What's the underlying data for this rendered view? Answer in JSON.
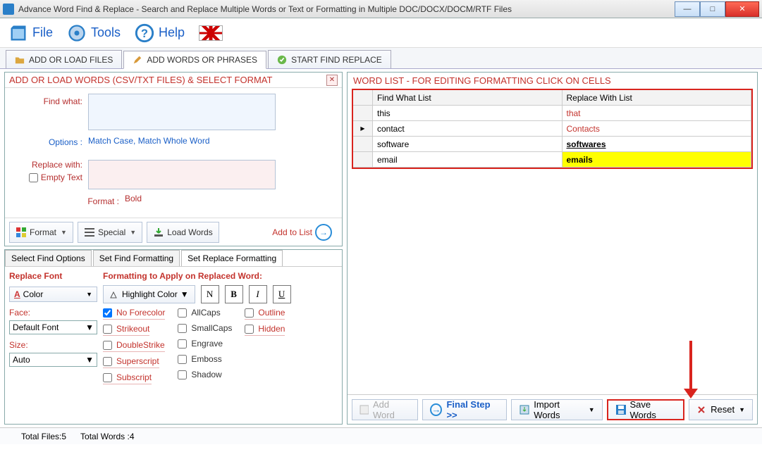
{
  "window": {
    "title": "Advance Word Find & Replace - Search and Replace Multiple Words or Text  or Formatting in Multiple DOC/DOCX/DOCM/RTF Files"
  },
  "menubar": {
    "file": "File",
    "tools": "Tools",
    "help": "Help"
  },
  "tabs": {
    "load_files": "ADD OR LOAD FILES",
    "add_words": "ADD WORDS OR PHRASES",
    "start": "START FIND REPLACE"
  },
  "left_panel": {
    "title": "ADD OR LOAD WORDS (CSV/TXT FILES) & SELECT FORMAT",
    "find_what": "Find what:",
    "options_label": "Options :",
    "options_value": "Match Case, Match Whole Word",
    "replace_with": "Replace with:",
    "empty_text": "Empty Text",
    "format_label": "Format :",
    "format_value": "Bold",
    "toolbar": {
      "format": "Format",
      "special": "Special",
      "load_words": "Load Words",
      "add_to_list": "Add to List"
    }
  },
  "subtabs": {
    "select_find_options": "Select Find Options",
    "set_find_formatting": "Set Find Formatting",
    "set_replace_formatting": "Set Replace Formatting"
  },
  "replace_font": {
    "title": "Replace Font",
    "color": "Color",
    "face_label": "Face:",
    "face_value": "Default Font",
    "size_label": "Size:",
    "size_value": "Auto"
  },
  "formatting": {
    "title": "Formatting to Apply on Replaced Word:",
    "highlight": "Highlight Color",
    "n": "N",
    "b": "B",
    "i": "I",
    "u": "U",
    "no_forecolor": "No Forecolor",
    "strikeout": "Strikeout",
    "doublestrike": "DoubleStrike",
    "superscript": "Superscript",
    "subscript": "Subscript",
    "allcaps": "AllCaps",
    "smallcaps": "SmallCaps",
    "engrave": "Engrave",
    "emboss": "Emboss",
    "shadow": "Shadow",
    "outline": "Outline",
    "hidden": "Hidden"
  },
  "right_panel": {
    "title": "WORD LIST - FOR EDITING FORMATTING CLICK ON CELLS",
    "col_find": "Find What List",
    "col_replace": "Replace With List",
    "rows": [
      {
        "find": "this",
        "replace": "that",
        "style": "red"
      },
      {
        "find": "contact",
        "replace": "Contacts",
        "style": "sel_red"
      },
      {
        "find": "software",
        "replace": "softwares",
        "style": "underline"
      },
      {
        "find": "email",
        "replace": "emails",
        "style": "yellow"
      }
    ]
  },
  "right_buttons": {
    "add_word": "Add Word",
    "final_step": "Final Step >>",
    "import_words": "Import Words",
    "save_words": "Save Words",
    "reset": "Reset"
  },
  "status": {
    "total_files": "Total Files:5",
    "total_words": "Total Words :4"
  }
}
